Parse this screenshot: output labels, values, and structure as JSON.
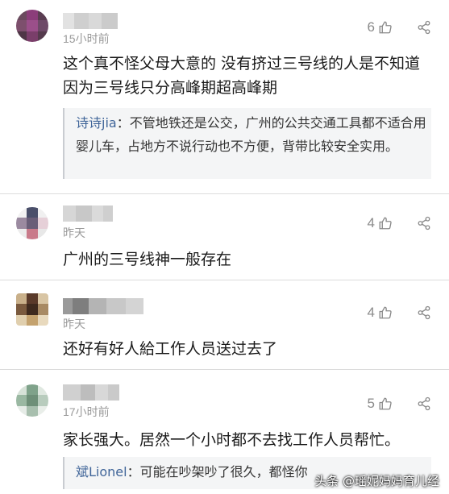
{
  "comments": [
    {
      "time": "15小时前",
      "likes": "6",
      "text": "这个真不怪父母大意的 没有挤过三号线的人是不知道因为三号线只分高峰期超高峰期",
      "reply": {
        "name": "诗诗jia",
        "text": "：不管地铁还是公交，广州的公共交通工具都不适合用婴儿车，占地方不说行动也不方便，背带比较安全实用。"
      }
    },
    {
      "time": "昨天",
      "likes": "4",
      "text": "广州的三号线神一般存在"
    },
    {
      "time": "昨天",
      "likes": "4",
      "text": "还好有好人給工作人员送过去了"
    },
    {
      "time": "17小时前",
      "likes": "5",
      "text": "家长强大。居然一个小时都不去找工作人员帮忙。",
      "reply": {
        "name": "斌Lionel",
        "text": "：可能在吵架吵了很久，都怪你"
      }
    }
  ],
  "watermark": "头条 @瑶妮妈妈育儿经",
  "colors": {
    "reply_name": "#406599",
    "meta_gray": "#9a9a9a",
    "divider": "#dcdcdc"
  },
  "icons": [
    "thumbs-up-icon",
    "share-icon"
  ]
}
